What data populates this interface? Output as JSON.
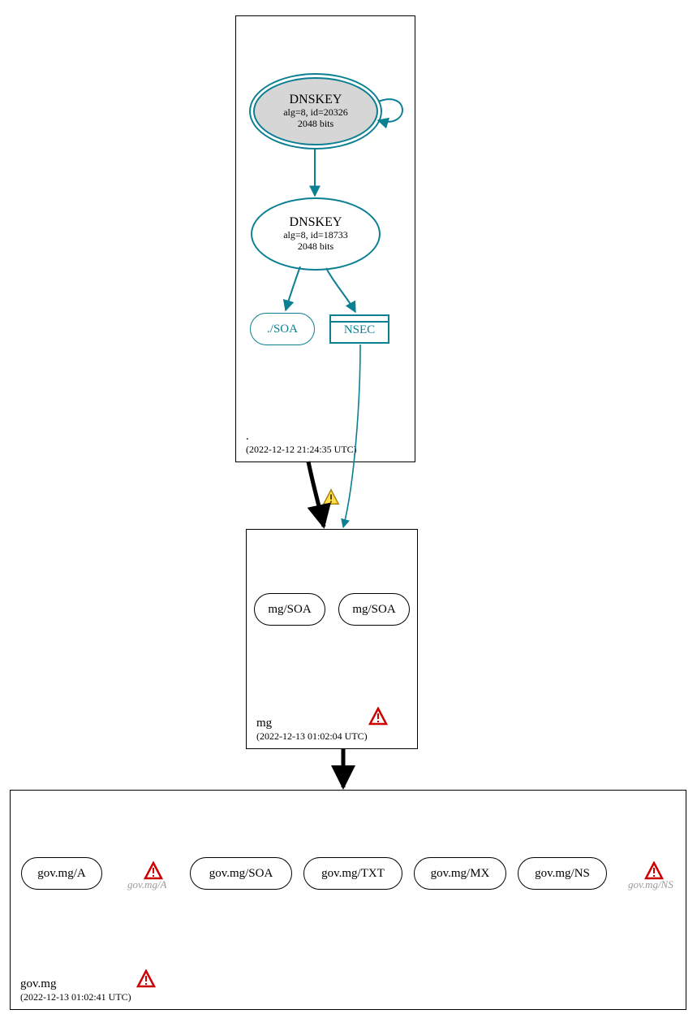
{
  "zones": {
    "root": {
      "name": ".",
      "timestamp": "(2022-12-12 21:24:35 UTC)",
      "keys": {
        "ksk": {
          "title": "DNSKEY",
          "alg": "alg=8, id=20326",
          "bits": "2048 bits"
        },
        "zsk": {
          "title": "DNSKEY",
          "alg": "alg=8, id=18733",
          "bits": "2048 bits"
        }
      },
      "soa": "./SOA",
      "nsec": "NSEC"
    },
    "mg": {
      "name": "mg",
      "timestamp": "(2022-12-13 01:02:04 UTC)",
      "soa1": "mg/SOA",
      "soa2": "mg/SOA"
    },
    "govmg": {
      "name": "gov.mg",
      "timestamp": "(2022-12-13 01:02:41 UTC)",
      "a": "gov.mg/A",
      "a_ghost": "gov.mg/A",
      "soa": "gov.mg/SOA",
      "txt": "gov.mg/TXT",
      "mx": "gov.mg/MX",
      "ns": "gov.mg/NS",
      "ns_ghost": "gov.mg/NS"
    }
  }
}
